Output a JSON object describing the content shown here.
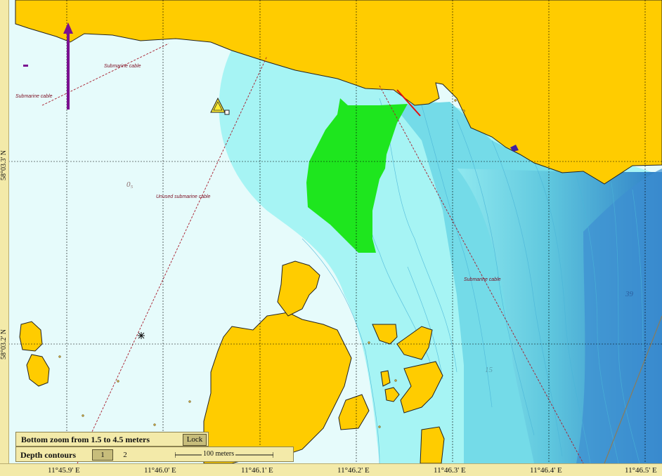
{
  "map": {
    "labels": {
      "submarine_cable_1": "Submarine cable",
      "submarine_cable_2": "Submarine cable",
      "submarine_cable_3": "Submarine cable",
      "unused_cable": "Unused submarine cable",
      "depth_0": "0₅",
      "depth_39": "39",
      "depth_15": "15"
    },
    "latitudes": [
      "58°03.3' N",
      "58°03.2' N"
    ],
    "longitudes": [
      "11°45.9' E",
      "11°46.0' E",
      "11°46.1' E",
      "11°46.2' E",
      "11°46.3' E",
      "11°46.4' E",
      "11°46.5' E"
    ],
    "colors": {
      "land": "#ffcc00",
      "shallow_water": "#e6fbfb",
      "light_blue": "#a6f4f4",
      "mid_blue": "#6ed8e6",
      "deep_blue": "#3a8fd0",
      "safety_area": "#1ee61e",
      "cable": "#a81c2c",
      "grid": "#000000"
    },
    "icons": {
      "north_arrow": "north-arrow-icon",
      "hazard_triangle": "warning-triangle-icon",
      "rock": "rock-asterisk-icon"
    }
  },
  "panels": {
    "zoom": {
      "text": "Bottom zoom from 1.5 to 4.5 meters",
      "lock_label": "Lock"
    },
    "depth": {
      "text": "Depth contours",
      "btn1": "1",
      "btn2": "2",
      "scale_label": "100 meters"
    }
  }
}
